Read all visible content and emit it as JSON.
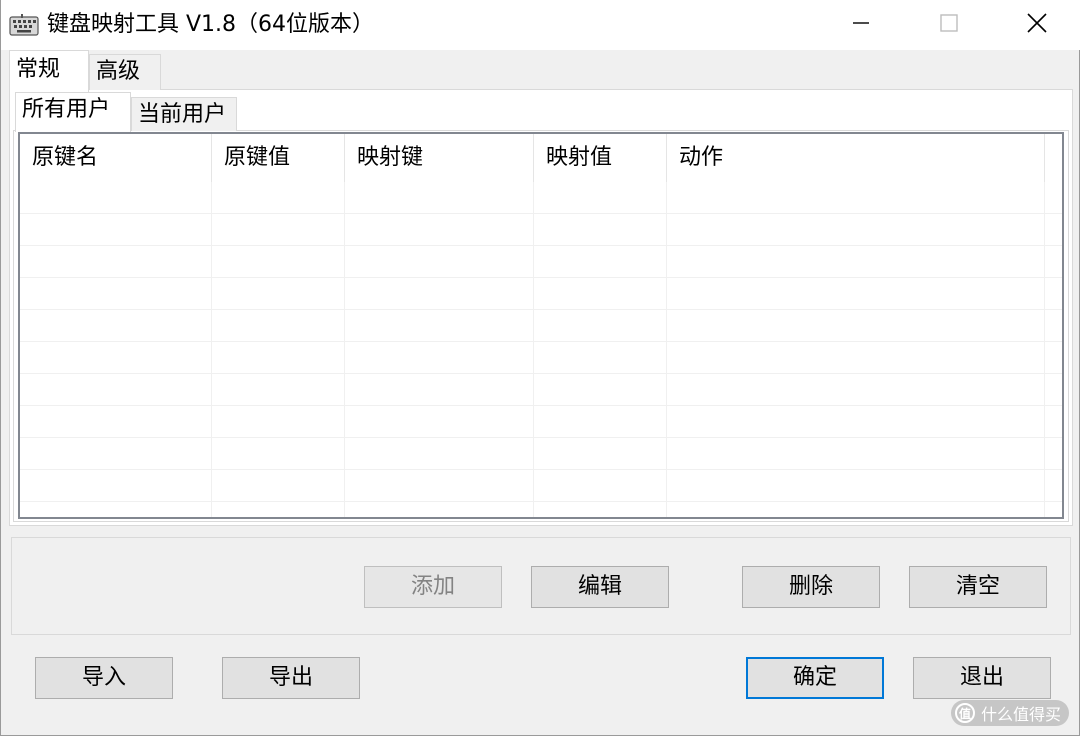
{
  "window": {
    "title": "键盘映射工具 V1.8（64位版本）",
    "app_icon": "keyboard-icon",
    "controls": {
      "minimize_icon": "minimize-icon",
      "maximize_icon": "maximize-icon",
      "close_icon": "close-icon"
    }
  },
  "outer_tabs": [
    {
      "label": "常规",
      "active": true
    },
    {
      "label": "高级",
      "active": false
    }
  ],
  "inner_tabs": [
    {
      "label": "所有用户",
      "active": true
    },
    {
      "label": "当前用户",
      "active": false
    }
  ],
  "list": {
    "columns": [
      "原键名",
      "原键值",
      "映射键",
      "映射值",
      "动作"
    ],
    "rows": []
  },
  "actions": {
    "add_label": "添加",
    "add_enabled": false,
    "edit_label": "编辑",
    "delete_label": "删除",
    "clear_label": "清空"
  },
  "footer": {
    "import_label": "导入",
    "export_label": "导出",
    "ok_label": "确定",
    "exit_label": "退出"
  },
  "watermark": {
    "icon_text": "值",
    "text": "什么值得买"
  },
  "colors": {
    "accent": "#0078d7",
    "window_bg": "#f0f0f0",
    "listview_border": "#828790"
  }
}
